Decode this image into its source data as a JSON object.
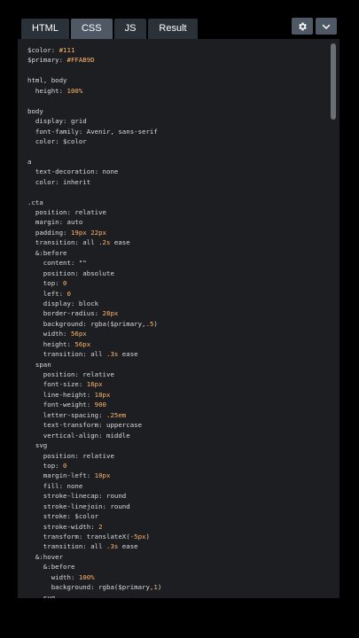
{
  "tabs": [
    {
      "label": "HTML",
      "active": false
    },
    {
      "label": "CSS",
      "active": true
    },
    {
      "label": "JS",
      "active": false
    },
    {
      "label": "Result",
      "active": false
    }
  ],
  "controls": {
    "settings_icon": "gear-icon",
    "collapse_icon": "chevron-down-icon"
  },
  "colors": {
    "editor_bg": "#1d1e22",
    "tab_bg": "#2b3139",
    "tab_active_bg": "#4f5966",
    "value_color": "#ffb56b"
  },
  "code_lines": [
    [
      {
        "t": "$color: ",
        "c": "k"
      },
      {
        "t": "#111",
        "c": "v"
      }
    ],
    [
      {
        "t": "$primary: ",
        "c": "k"
      },
      {
        "t": "#FFAB9D",
        "c": "v"
      }
    ],
    [
      {
        "t": "",
        "c": "k"
      }
    ],
    [
      {
        "t": "html, body",
        "c": "k"
      }
    ],
    [
      {
        "t": "  height: ",
        "c": "k"
      },
      {
        "t": "100%",
        "c": "v"
      }
    ],
    [
      {
        "t": "",
        "c": "k"
      }
    ],
    [
      {
        "t": "body",
        "c": "k"
      }
    ],
    [
      {
        "t": "  display: grid",
        "c": "k"
      }
    ],
    [
      {
        "t": "  font-family: Avenir, sans-serif",
        "c": "k"
      }
    ],
    [
      {
        "t": "  color: $color",
        "c": "k"
      }
    ],
    [
      {
        "t": "",
        "c": "k"
      }
    ],
    [
      {
        "t": "a",
        "c": "k"
      }
    ],
    [
      {
        "t": "  text-decoration: none",
        "c": "k"
      }
    ],
    [
      {
        "t": "  color: inherit",
        "c": "k"
      }
    ],
    [
      {
        "t": "",
        "c": "k"
      }
    ],
    [
      {
        "t": ".cta",
        "c": "k"
      }
    ],
    [
      {
        "t": "  position: relative",
        "c": "k"
      }
    ],
    [
      {
        "t": "  margin: auto",
        "c": "k"
      }
    ],
    [
      {
        "t": "  padding: ",
        "c": "k"
      },
      {
        "t": "19px 22px",
        "c": "v"
      }
    ],
    [
      {
        "t": "  transition: all ",
        "c": "k"
      },
      {
        "t": ".2s",
        "c": "v"
      },
      {
        "t": " ease",
        "c": "k"
      }
    ],
    [
      {
        "t": "  &:before",
        "c": "k"
      }
    ],
    [
      {
        "t": "    content: \"\"",
        "c": "k"
      }
    ],
    [
      {
        "t": "    position: absolute",
        "c": "k"
      }
    ],
    [
      {
        "t": "    top: ",
        "c": "k"
      },
      {
        "t": "0",
        "c": "v"
      }
    ],
    [
      {
        "t": "    left: ",
        "c": "k"
      },
      {
        "t": "0",
        "c": "v"
      }
    ],
    [
      {
        "t": "    display: block",
        "c": "k"
      }
    ],
    [
      {
        "t": "    border-radius: ",
        "c": "k"
      },
      {
        "t": "28px",
        "c": "v"
      }
    ],
    [
      {
        "t": "    background: rgba($primary,",
        "c": "k"
      },
      {
        "t": ".5",
        "c": "v"
      },
      {
        "t": ")",
        "c": "k"
      }
    ],
    [
      {
        "t": "    width: ",
        "c": "k"
      },
      {
        "t": "56px",
        "c": "v"
      }
    ],
    [
      {
        "t": "    height: ",
        "c": "k"
      },
      {
        "t": "56px",
        "c": "v"
      }
    ],
    [
      {
        "t": "    transition: all ",
        "c": "k"
      },
      {
        "t": ".3s",
        "c": "v"
      },
      {
        "t": " ease",
        "c": "k"
      }
    ],
    [
      {
        "t": "  span",
        "c": "k"
      }
    ],
    [
      {
        "t": "    position: relative",
        "c": "k"
      }
    ],
    [
      {
        "t": "    font-size: ",
        "c": "k"
      },
      {
        "t": "16px",
        "c": "v"
      }
    ],
    [
      {
        "t": "    line-height: ",
        "c": "k"
      },
      {
        "t": "18px",
        "c": "v"
      }
    ],
    [
      {
        "t": "    font-weight: ",
        "c": "k"
      },
      {
        "t": "900",
        "c": "v"
      }
    ],
    [
      {
        "t": "    letter-spacing: ",
        "c": "k"
      },
      {
        "t": ".25em",
        "c": "v"
      }
    ],
    [
      {
        "t": "    text-transform: uppercase",
        "c": "k"
      }
    ],
    [
      {
        "t": "    vertical-align: middle",
        "c": "k"
      }
    ],
    [
      {
        "t": "  svg",
        "c": "k"
      }
    ],
    [
      {
        "t": "    position: relative",
        "c": "k"
      }
    ],
    [
      {
        "t": "    top: ",
        "c": "k"
      },
      {
        "t": "0",
        "c": "v"
      }
    ],
    [
      {
        "t": "    margin-left: ",
        "c": "k"
      },
      {
        "t": "10px",
        "c": "v"
      }
    ],
    [
      {
        "t": "    fill: none",
        "c": "k"
      }
    ],
    [
      {
        "t": "    stroke-linecap: round",
        "c": "k"
      }
    ],
    [
      {
        "t": "    stroke-linejoin: round",
        "c": "k"
      }
    ],
    [
      {
        "t": "    stroke: $color",
        "c": "k"
      }
    ],
    [
      {
        "t": "    stroke-width: ",
        "c": "k"
      },
      {
        "t": "2",
        "c": "v"
      }
    ],
    [
      {
        "t": "    transform: translateX(",
        "c": "k"
      },
      {
        "t": "-5px",
        "c": "v"
      },
      {
        "t": ")",
        "c": "k"
      }
    ],
    [
      {
        "t": "    transition: all ",
        "c": "k"
      },
      {
        "t": ".3s",
        "c": "v"
      },
      {
        "t": " ease",
        "c": "k"
      }
    ],
    [
      {
        "t": "  &:hover",
        "c": "k"
      }
    ],
    [
      {
        "t": "    &:before",
        "c": "k"
      }
    ],
    [
      {
        "t": "      width: ",
        "c": "k"
      },
      {
        "t": "100%",
        "c": "v"
      }
    ],
    [
      {
        "t": "      background: rgba($primary,",
        "c": "k"
      },
      {
        "t": "1",
        "c": "v"
      },
      {
        "t": ")",
        "c": "k"
      }
    ],
    [
      {
        "t": "    svg",
        "c": "k"
      }
    ]
  ]
}
